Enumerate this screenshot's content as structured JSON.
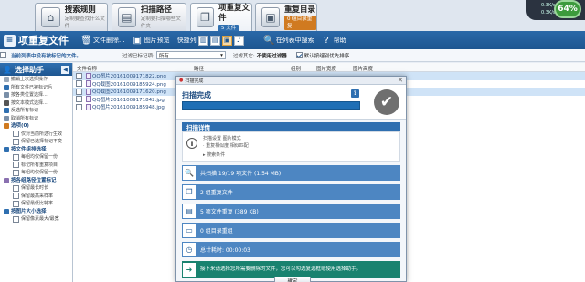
{
  "tabs": [
    {
      "title": "搜索规则",
      "subtitle": "定制要查找什么文件",
      "icon": "search-home-icon"
    },
    {
      "title": "扫描路径",
      "subtitle": "定制要扫描哪些文件夹",
      "icon": "folder-scan-icon"
    },
    {
      "title": "项重复文件",
      "subtitle": "",
      "badge": "5 文件",
      "badge_color": "#2f6fb0",
      "icon": "duplicate-files-icon"
    },
    {
      "title": "重复目录",
      "subtitle": "",
      "badge": "0 组目录重复",
      "badge_color": "#d07a20",
      "icon": "duplicate-folders-icon"
    }
  ],
  "net": {
    "up": "0.3K/s",
    "down": "0.3K/s",
    "percent": "64%"
  },
  "toolbar": {
    "title": "项重复文件",
    "delete_label": "文件删除...",
    "preview_label": "图片预览",
    "shortcut_label": "快捷列",
    "search_label": "在列表中搜索",
    "help_label": "帮助"
  },
  "filter": {
    "hint": "当前列表中没有被标记的文件。",
    "filter_label": "过滤已标记项:",
    "filter_value": "所有",
    "filter_label2": "过滤其它:",
    "filter_value2": "不使用过滤器",
    "sort_label": "默认按组别优先排序"
  },
  "sidebar": {
    "title": "选择助手",
    "items": [
      {
        "label": "撤销上次选择操作",
        "kind": "item",
        "color": "#9aa8b8"
      },
      {
        "label": "所有文件已被标记后",
        "kind": "item",
        "color": "#2f6fb0"
      },
      {
        "label": "按各类位置选择...",
        "kind": "item",
        "color": "#7a8fa8"
      },
      {
        "label": "按文本模式选择...",
        "kind": "item",
        "color": "#555"
      },
      {
        "label": "反选所有标记",
        "kind": "item",
        "color": "#2f6fb0"
      },
      {
        "label": "取消所有标记",
        "kind": "item",
        "color": "#7a8fa8"
      },
      {
        "label": "选项(0)",
        "kind": "sec",
        "color": "#d07a20"
      },
      {
        "label": "仅对当前所选行生效",
        "kind": "sub",
        "color": ""
      },
      {
        "label": "保留已选择标记不变",
        "kind": "sub",
        "color": ""
      },
      {
        "label": "按文件组排选择",
        "kind": "sec",
        "color": "#2f6fb0"
      },
      {
        "label": "每组均仅保留一份",
        "kind": "sub",
        "color": ""
      },
      {
        "label": "标记所有重复项目",
        "kind": "sub",
        "color": ""
      },
      {
        "label": "每组均仅保留一份",
        "kind": "sub",
        "color": ""
      },
      {
        "label": "按各组路径位置标记",
        "kind": "sec",
        "color": "#8a70b0"
      },
      {
        "label": "保留最长时长",
        "kind": "sub",
        "color": ""
      },
      {
        "label": "保留最高采样率",
        "kind": "sub",
        "color": ""
      },
      {
        "label": "保留最低比特率",
        "kind": "sub",
        "color": ""
      },
      {
        "label": "按图片大小选择",
        "kind": "sec",
        "color": "#2f6fb0"
      },
      {
        "label": "保留像素最大/最宽",
        "kind": "sub",
        "color": ""
      }
    ]
  },
  "columns": {
    "name": "文件名称",
    "path": "路径",
    "group": "组别",
    "width": "图片宽度",
    "height": "图片高度"
  },
  "files": [
    {
      "name": "QQ图片20161009171822.png",
      "selected": true
    },
    {
      "name": "QQ截图20161009185924.png",
      "selected": false
    },
    {
      "name": "QQ截图20161009171620.png",
      "selected": true
    },
    {
      "name": "QQ图片20161009171842.jpg",
      "selected": false
    },
    {
      "name": "QQ图片20161009185948.jpg",
      "selected": false
    }
  ],
  "dialog": {
    "window_title": "扫描完成",
    "heading": "扫描完成",
    "details_title": "扫描详情",
    "detail_lines": [
      "扫描设置 图片模式",
      "· 重复相似度 相似匹配",
      "▸ 搜索条件"
    ],
    "results": [
      {
        "icon": "magnifier-icon",
        "glyph": "🔍",
        "text": "共扫描 19/19 项文件 (1.54 MB)"
      },
      {
        "icon": "copy-group-icon",
        "glyph": "❐",
        "text": "2 组重复文件"
      },
      {
        "icon": "files-dup-icon",
        "glyph": "▤",
        "text": "5 项文件重复 (389 KB)"
      },
      {
        "icon": "folder-group-icon",
        "glyph": "▭",
        "text": "0 组目录重组"
      },
      {
        "icon": "clock-icon",
        "glyph": "◷",
        "text": "总计耗时: 00:00:03"
      }
    ],
    "note": "接下来请选择您所需要删除的文件，您可以勾选复选框或使用选择助手。",
    "ok_label": "确定"
  }
}
